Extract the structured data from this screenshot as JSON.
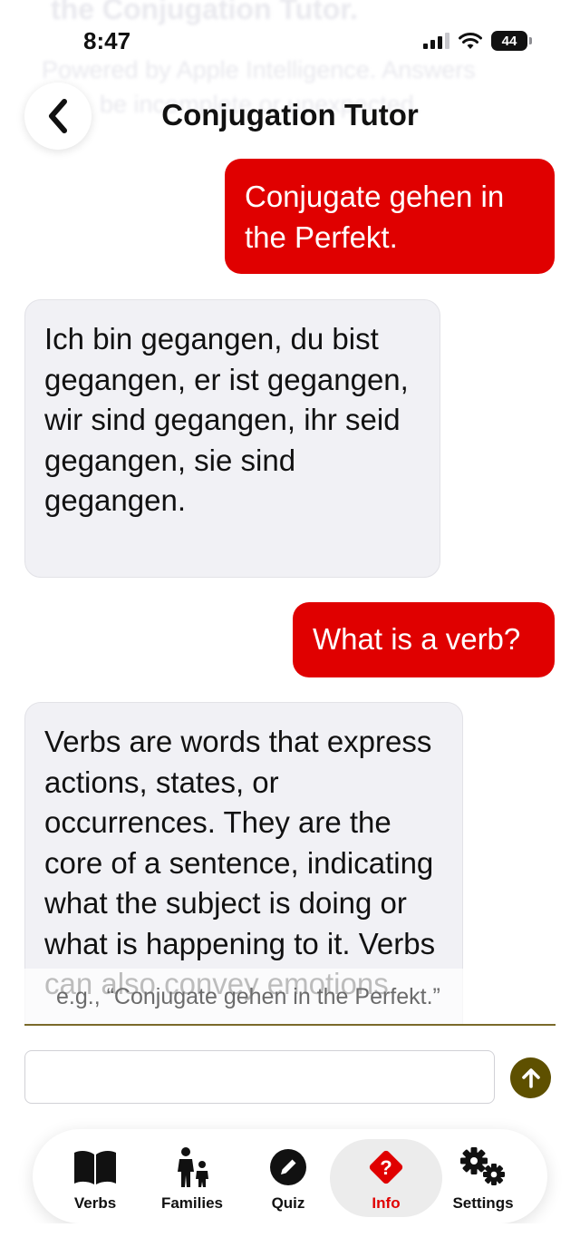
{
  "background_header": {
    "title": "the Conjugation Tutor.",
    "subtitle_line1": "Powered by Apple Intelligence. Answers",
    "subtitle_line2": "be incomplete or unexpected."
  },
  "status_bar": {
    "time": "8:47",
    "battery": "44"
  },
  "header": {
    "title": "Conjugation Tutor"
  },
  "messages": [
    {
      "role": "user",
      "text": "Conjugate gehen in the Perfekt."
    },
    {
      "role": "assistant",
      "text": "Ich bin gegangen, du bist gegangen, er ist gegangen, wir sind gegangen, ihr seid gegangen, sie sind gegangen."
    },
    {
      "role": "user",
      "text": "What is a verb?"
    },
    {
      "role": "assistant",
      "text": "Verbs are words that express actions, states, or occurrences. They are the core of a sentence, indicating what the subject is doing or what is happening to it. Verbs can also convey emotions"
    }
  ],
  "composer": {
    "hint": "e.g., “Conjugate gehen in the Perfekt.”",
    "value": ""
  },
  "tabs": [
    {
      "label": "Verbs",
      "icon": "book-icon"
    },
    {
      "label": "Families",
      "icon": "family-icon"
    },
    {
      "label": "Quiz",
      "icon": "pencil-icon"
    },
    {
      "label": "Info",
      "icon": "question-icon",
      "active": true
    },
    {
      "label": "Settings",
      "icon": "gears-icon"
    }
  ],
  "colors": {
    "accent_red": "#e00000",
    "send_button": "#5e5000",
    "assistant_bubble": "#f1f1f5"
  }
}
